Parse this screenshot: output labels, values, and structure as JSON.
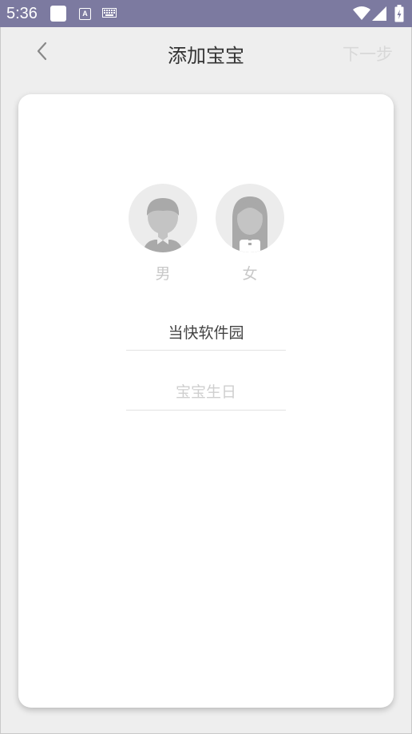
{
  "status_bar": {
    "time": "5:36",
    "icons": [
      "app-square-icon",
      "font-a-icon",
      "keyboard-icon",
      "wifi-icon",
      "signal-icon",
      "battery-icon"
    ],
    "a_glyph": "A"
  },
  "toolbar": {
    "back_icon": "chevron-left-icon",
    "title": "添加宝宝",
    "next_label": "下一步"
  },
  "form": {
    "gender": {
      "male_label": "男",
      "female_label": "女"
    },
    "name_value": "当快软件园",
    "birthday_placeholder": "宝宝生日"
  },
  "colors": {
    "status_bar_bg": "#7c7aa0",
    "page_bg": "#eeeeee",
    "card_bg": "#ffffff",
    "avatar_fill": "#a9a9a9",
    "disabled_text": "#d8d8d8"
  }
}
